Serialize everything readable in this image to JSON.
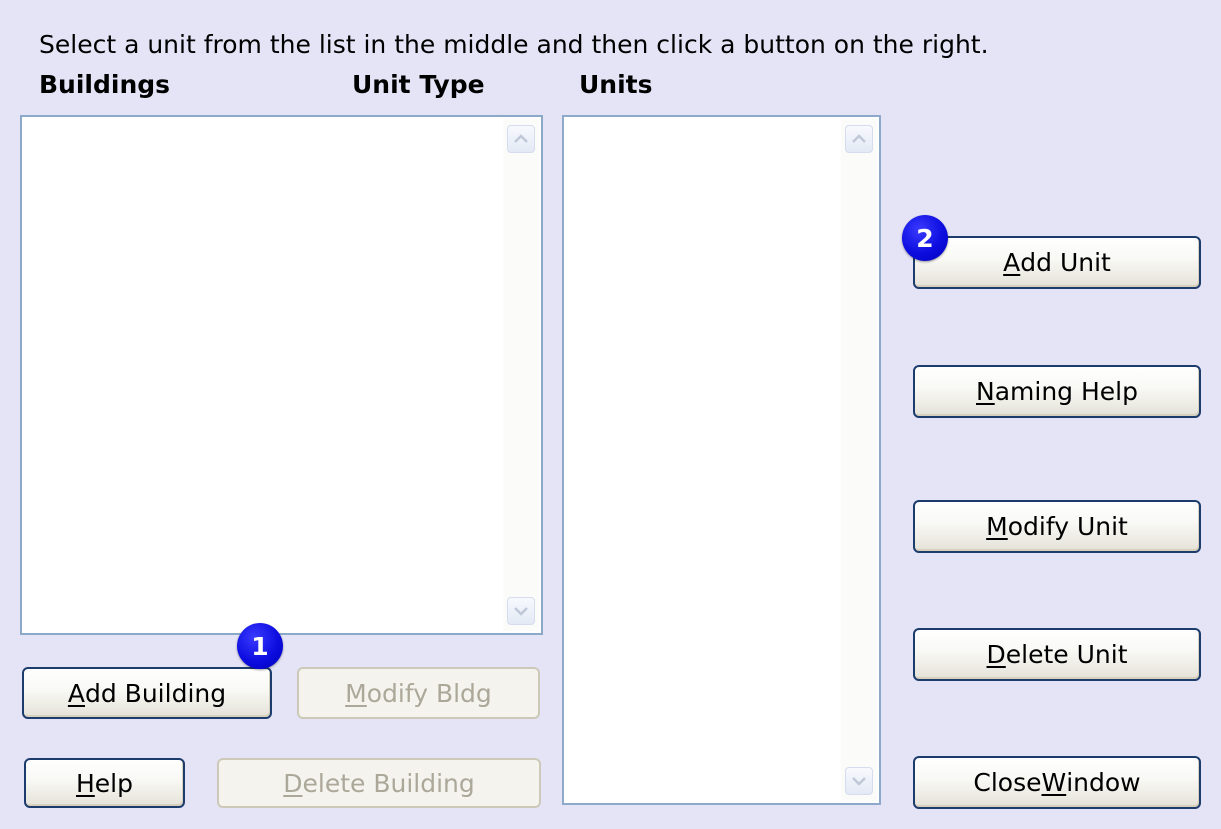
{
  "instruction": "Select a unit from the list in the middle and then click a button on the right.",
  "headers": {
    "buildings": "Buildings",
    "unit_type": "Unit Type",
    "units": "Units"
  },
  "lists": {
    "buildings_items": [],
    "units_items": []
  },
  "buttons": {
    "add_building": {
      "pre": "",
      "mn": "A",
      "post": "dd Building",
      "enabled": true
    },
    "modify_bldg": {
      "pre": "",
      "mn": "M",
      "post": "odify Bldg",
      "enabled": false
    },
    "help": {
      "pre": "",
      "mn": "H",
      "post": "elp",
      "enabled": true
    },
    "delete_building": {
      "pre": "",
      "mn": "D",
      "post": "elete Building",
      "enabled": false
    },
    "add_unit": {
      "pre": "",
      "mn": "A",
      "post": "dd Unit",
      "enabled": true
    },
    "naming_help": {
      "pre": "",
      "mn": "N",
      "post": "aming Help",
      "enabled": true
    },
    "modify_unit": {
      "pre": "",
      "mn": "M",
      "post": "odify Unit",
      "enabled": true
    },
    "delete_unit": {
      "pre": "",
      "mn": "D",
      "post": "elete Unit",
      "enabled": true
    },
    "close_window": {
      "pre": "Close ",
      "mn": "W",
      "post": "indow",
      "enabled": true
    }
  },
  "badges": {
    "step1": "1",
    "step2": "2"
  },
  "icons": {
    "scroll_up": "chevron-up-icon",
    "scroll_down": "chevron-down-icon"
  },
  "colors": {
    "background": "#e4e4f6",
    "listbox_border": "#8da9c9",
    "button_border": "#1d3c6e",
    "disabled_text": "#aca899",
    "badge": "#0d0de0"
  }
}
